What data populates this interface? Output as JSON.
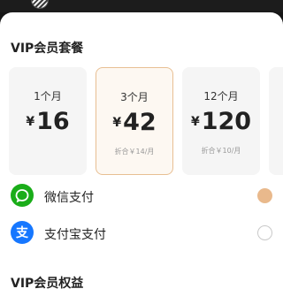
{
  "sections": {
    "plan_title": "VIP会员套餐",
    "benefits_title": "VIP会员权益"
  },
  "plans": [
    {
      "name": "1个月",
      "currency": "¥",
      "price": "16",
      "note": "",
      "selected": false
    },
    {
      "name": "3个月",
      "currency": "¥",
      "price": "42",
      "note": "折合￥14/月",
      "selected": true
    },
    {
      "name": "12个月",
      "currency": "¥",
      "price": "120",
      "note": "折合￥10/月",
      "selected": false
    }
  ],
  "payment_methods": [
    {
      "label": "微信支付",
      "icon": "wechat-pay-icon",
      "color": "#1aad19",
      "selected": true
    },
    {
      "label": "支付宝支付",
      "icon": "alipay-icon",
      "color": "#1677ff",
      "selected": false
    }
  ],
  "colors": {
    "accent": "#e9b98c",
    "selected_border": "#e8bf93",
    "background_dark": "#161616"
  }
}
